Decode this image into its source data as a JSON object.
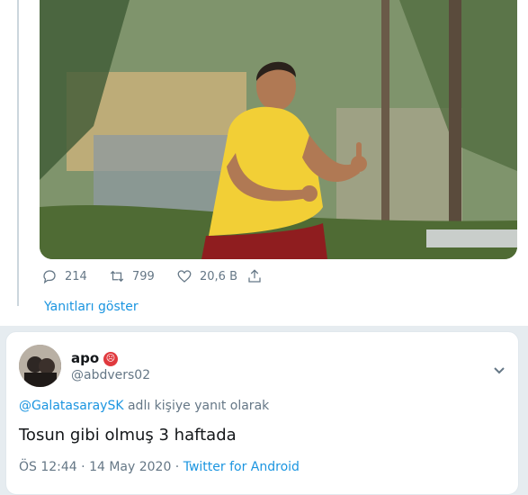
{
  "parent_tweet": {
    "stats": {
      "replies": "214",
      "retweets": "799",
      "likes": "20,6 B"
    },
    "show_replies": "Yanıtları göster"
  },
  "reply": {
    "author_name": "apo",
    "handle": "@abdvers02",
    "reply_to_mention": "@GalatasaraySK",
    "reply_to_suffix": " adlı kişiye yanıt olarak",
    "text": "Tosun gibi olmuş 3 haftada",
    "time": "ÖS 12:44",
    "date": "14 May 2020",
    "separator": " · ",
    "client": "Twitter for Android"
  },
  "colors": {
    "link": "#1b95e0",
    "muted": "#657786",
    "text": "#14171a"
  }
}
